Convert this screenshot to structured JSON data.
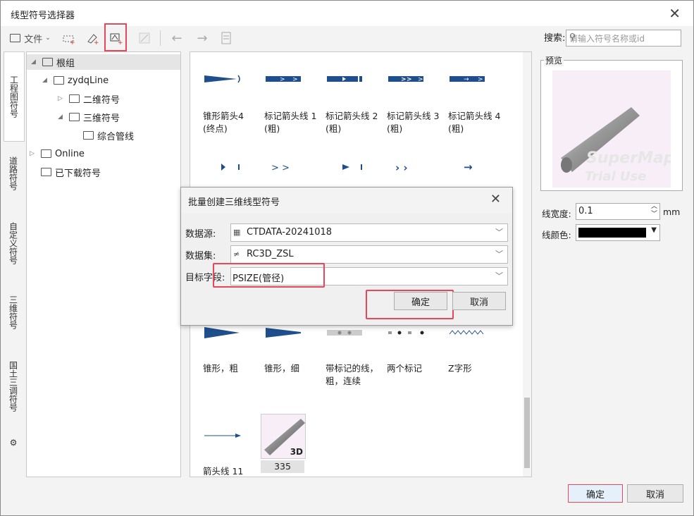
{
  "window": {
    "title": "线型符号选择器"
  },
  "toolbar": {
    "file_label": "文件",
    "search_label": "搜索:",
    "search_placeholder": "请输入符号名称或id"
  },
  "side_tabs": [
    "工程图符号",
    "道路符号",
    "自定义符号",
    "三维符号",
    "国土三调符号"
  ],
  "tree": {
    "root": "根组",
    "zydq": "zydqLine",
    "two_d": "二维符号",
    "three_d": "三维符号",
    "pipe": "综合管线",
    "online": "Online",
    "downloaded": "已下载符号"
  },
  "symbols": [
    {
      "label": "锥形箭头4 (终点)"
    },
    {
      "label": "标记箭头线 1 (粗)"
    },
    {
      "label": "标记箭头线 2 (粗)"
    },
    {
      "label": "标记箭头线 3 (粗)"
    },
    {
      "label": "标记箭头线 4 (粗)"
    },
    {
      "label": "锥形，粗"
    },
    {
      "label": "锥形，细"
    },
    {
      "label": "带标记的线，粗，连续"
    },
    {
      "label": "两个标记"
    },
    {
      "label": "Z字形"
    },
    {
      "label": "箭头线 11"
    },
    {
      "label": "335"
    }
  ],
  "preview": {
    "label": "预览",
    "watermark1": "SuperMap",
    "watermark2": "Trial Use",
    "badge": "3D"
  },
  "line_width": {
    "label": "线宽度:",
    "value": "0.1",
    "unit": "mm"
  },
  "line_color": {
    "label": "线颜色:",
    "value": "#000000"
  },
  "dialog": {
    "title": "批量创建三维线型符号",
    "source_label": "数据源:",
    "source_value": "CTDATA-20241018",
    "dataset_label": "数据集:",
    "dataset_value": "RC3D_ZSL",
    "field_label": "目标字段:",
    "field_value": "PSIZE(管径)",
    "ok": "确定",
    "cancel": "取消"
  },
  "footer": {
    "ok": "确定",
    "cancel": "取消"
  },
  "colors": {
    "accent": "#1f4e8c",
    "highlight": "#e8465a"
  }
}
